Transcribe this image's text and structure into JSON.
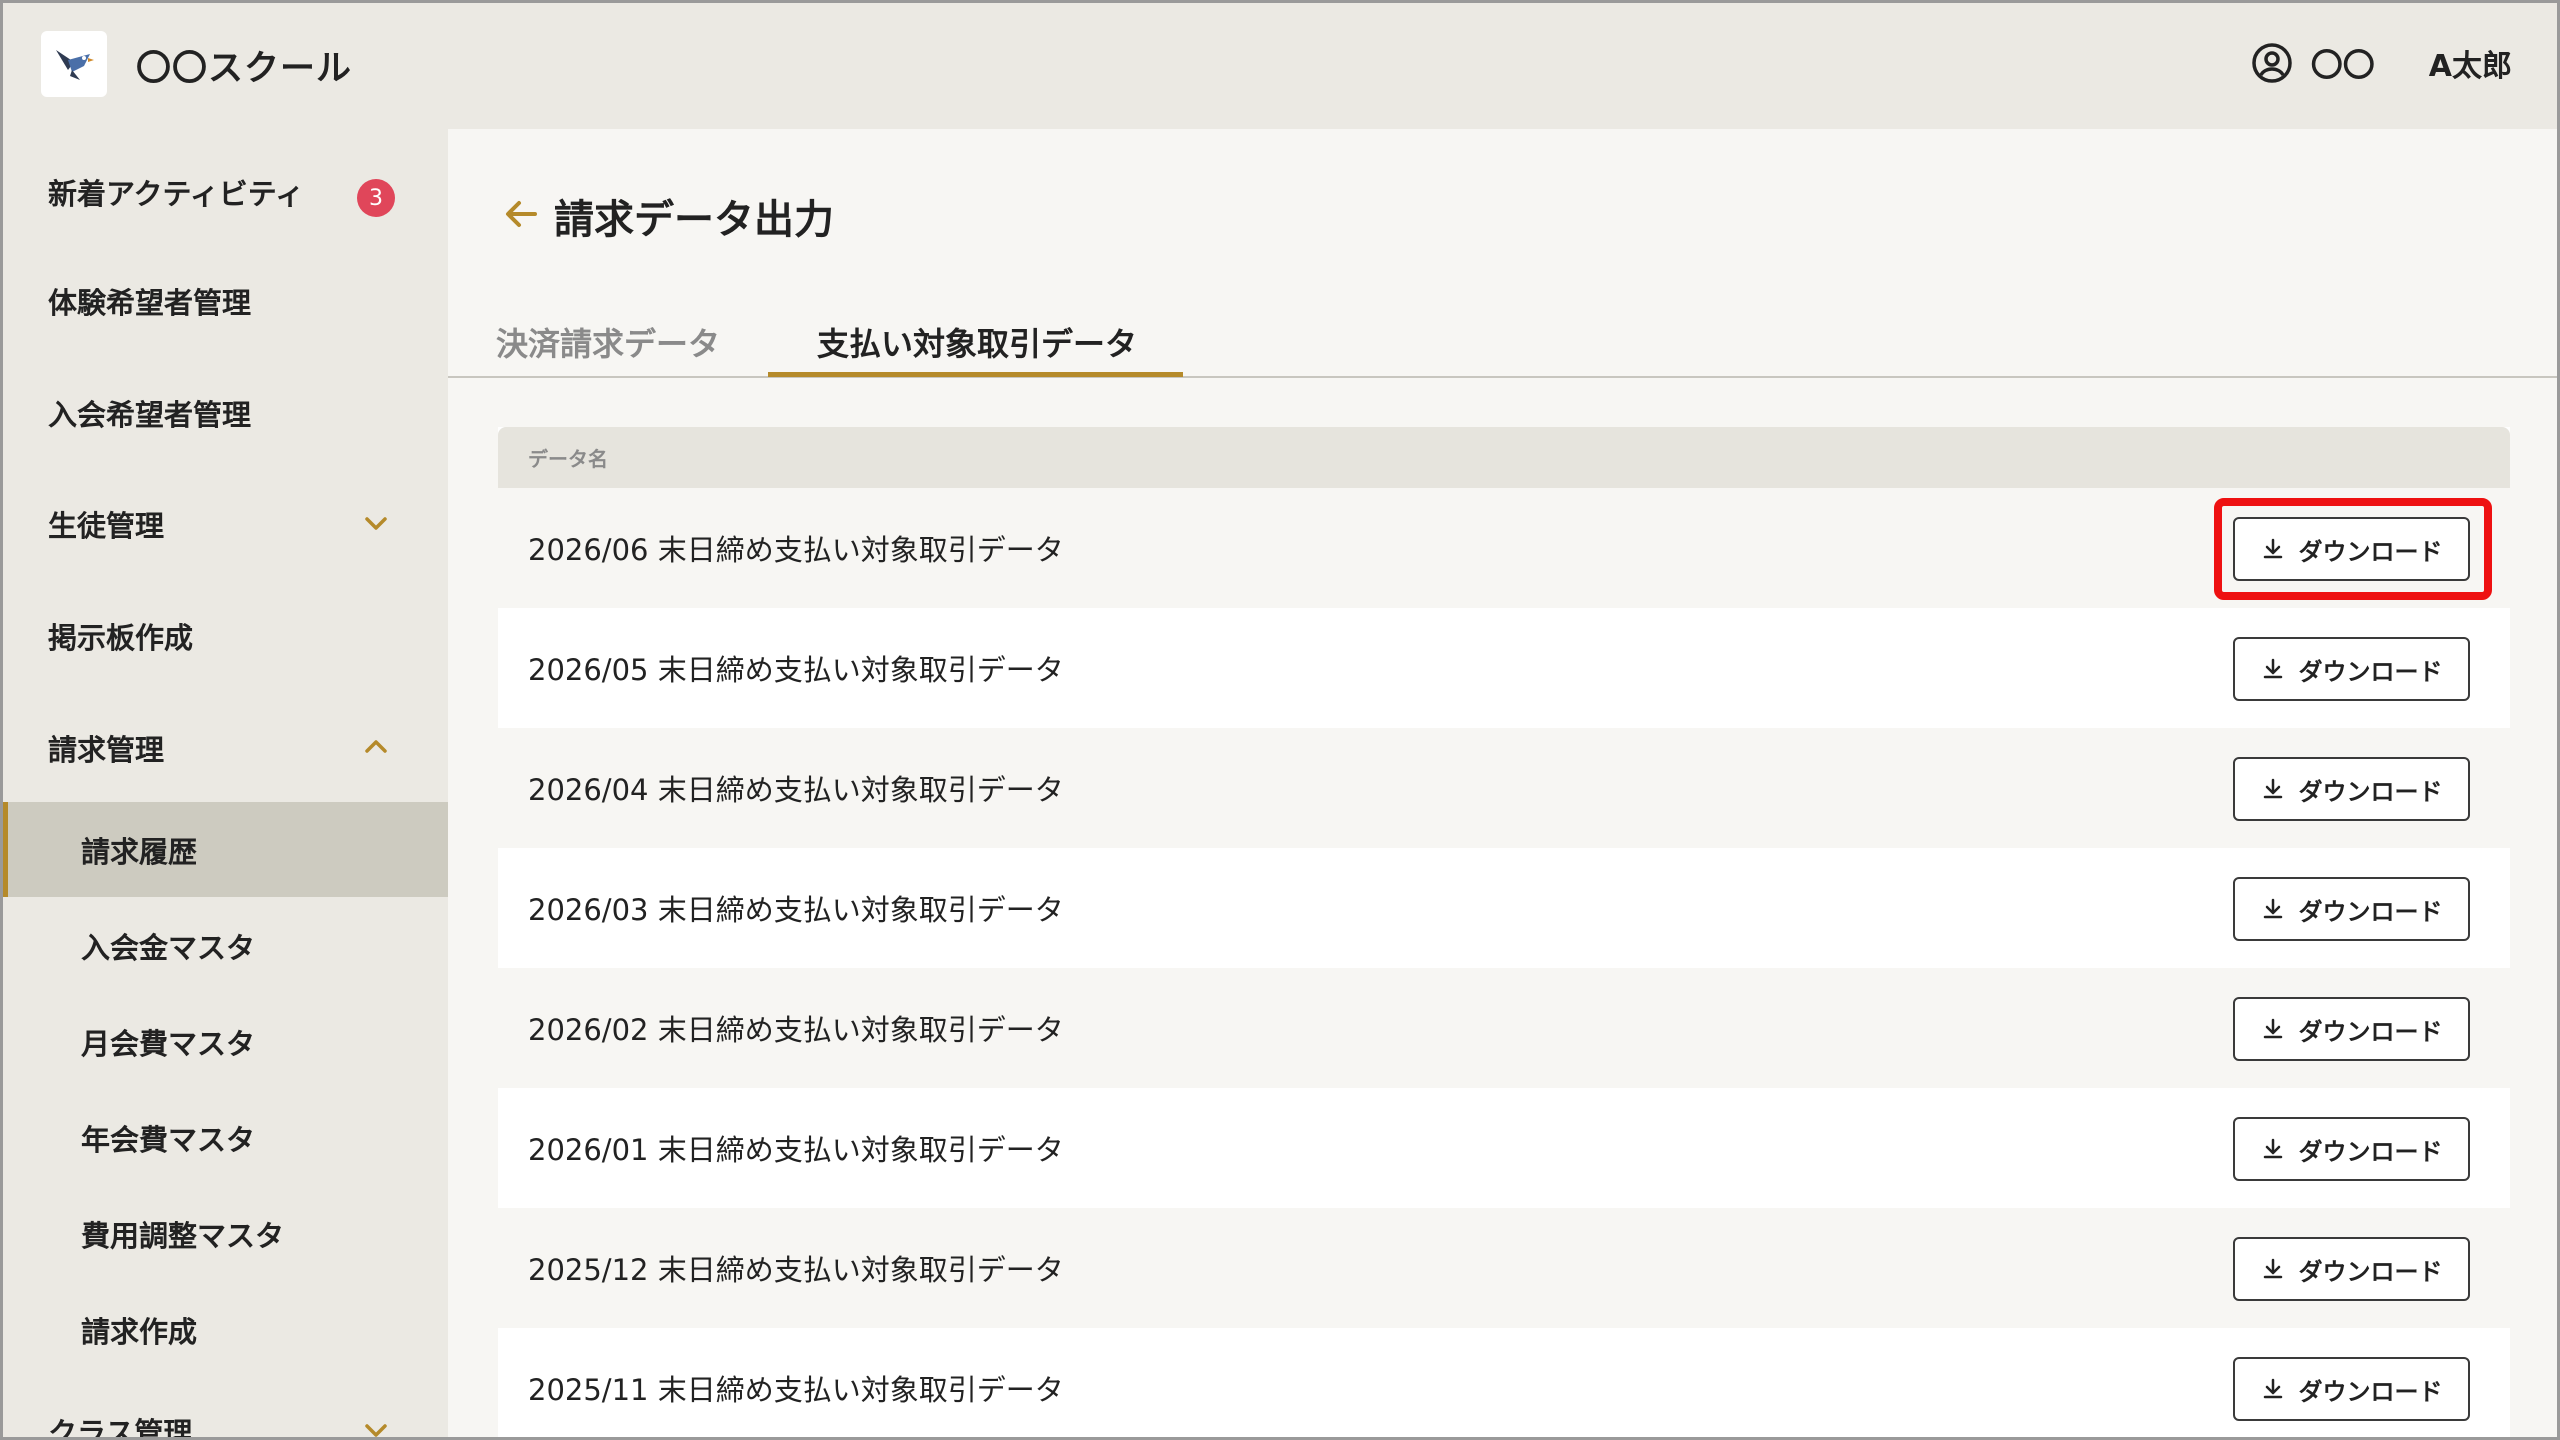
{
  "header": {
    "school_name": "〇〇スクール",
    "user_first": "〇〇",
    "user_last": "A太郎"
  },
  "sidebar": {
    "items": [
      {
        "label": "新着アクティビティ",
        "badge": "3"
      },
      {
        "label": "体験希望者管理"
      },
      {
        "label": "入会希望者管理"
      },
      {
        "label": "生徒管理",
        "chevron": "chevron-down-icon"
      },
      {
        "label": "掲示板作成"
      },
      {
        "label": "請求管理",
        "chevron": "chevron-up-icon"
      }
    ],
    "sub_items": [
      {
        "label": "請求履歴",
        "active": true
      },
      {
        "label": "入会金マスタ"
      },
      {
        "label": "月会費マスタ"
      },
      {
        "label": "年会費マスタ"
      },
      {
        "label": "費用調整マスタ"
      },
      {
        "label": "請求作成"
      }
    ],
    "cut_item": {
      "label": "クラス管理",
      "chevron": "chevron-down-icon"
    }
  },
  "main": {
    "title": "請求データ出力",
    "tabs": [
      {
        "label": "決済請求データ",
        "active": false
      },
      {
        "label": "支払い対象取引データ",
        "active": true
      }
    ],
    "table": {
      "column_header": "データ名",
      "download_label": "ダウンロード",
      "rows": [
        "2026/06 末日締め支払い対象取引データ",
        "2026/05 末日締め支払い対象取引データ",
        "2026/04 末日締め支払い対象取引データ",
        "2026/03 末日締め支払い対象取引データ",
        "2026/02 末日締め支払い対象取引データ",
        "2026/01 末日締め支払い対象取引データ",
        "2025/12 末日締め支払い対象取引データ",
        "2025/11 末日締め支払い対象取引データ"
      ]
    }
  },
  "colors": {
    "accent": "#b58a2a",
    "badge": "#e0465a",
    "highlight": "#ee1111",
    "sidebar_bg": "#ebe9e3",
    "active_bg": "#cdcbc0"
  }
}
